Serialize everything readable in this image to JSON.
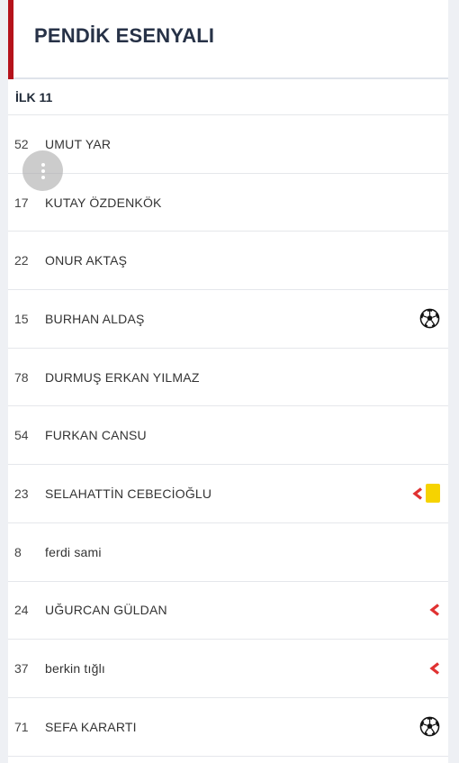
{
  "team": {
    "name": "PENDİK ESENYALI",
    "accent_color": "#b5121b"
  },
  "lineup": {
    "section_title": "İLK 11",
    "players": [
      {
        "number": "52",
        "name": "UMUT YAR",
        "events": []
      },
      {
        "number": "17",
        "name": "KUTAY ÖZDENKÖK",
        "events": []
      },
      {
        "number": "22",
        "name": "ONUR AKTAŞ",
        "events": []
      },
      {
        "number": "15",
        "name": "BURHAN ALDAŞ",
        "events": [
          "goal-icon"
        ]
      },
      {
        "number": "78",
        "name": "DURMUŞ ERKAN YILMAZ",
        "events": []
      },
      {
        "number": "54",
        "name": "FURKAN CANSU",
        "events": []
      },
      {
        "number": "23",
        "name": "SELAHATTİN CEBECİOĞLU",
        "events": [
          "substitution-out-icon",
          "yellow-card-icon"
        ]
      },
      {
        "number": "8",
        "name": "ferdi sami",
        "events": []
      },
      {
        "number": "24",
        "name": "UĞURCAN GÜLDAN",
        "events": [
          "substitution-out-icon"
        ]
      },
      {
        "number": "37",
        "name": "berkin tığlı",
        "events": [
          "substitution-out-icon"
        ]
      },
      {
        "number": "71",
        "name": "SEFA KARARTI",
        "events": [
          "goal-icon"
        ]
      }
    ]
  },
  "colors": {
    "yellow_card": "#f6d300",
    "substitution_out": "#e03131"
  }
}
